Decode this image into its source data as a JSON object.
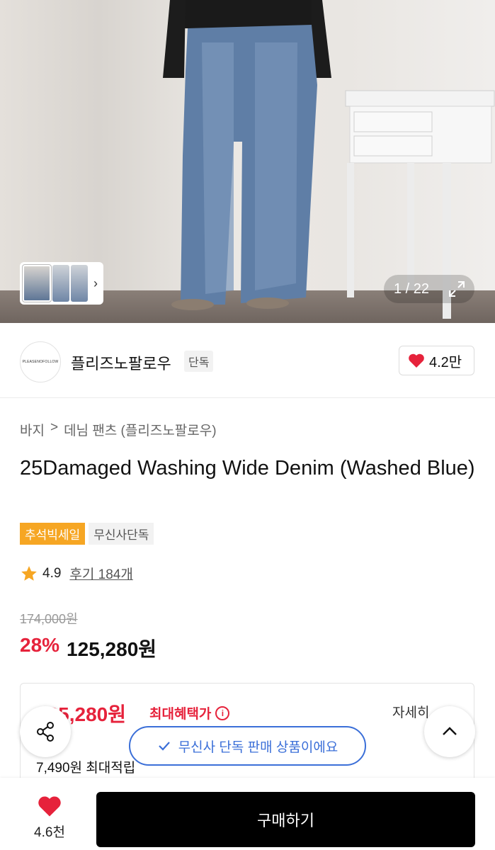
{
  "gallery": {
    "counter": "1 / 22",
    "thumb_chevron": "›"
  },
  "brand": {
    "logo_text": "PLEASENOFOLLOW",
    "name": "플리즈노팔로우",
    "badge": "단독",
    "likes": "4.2만"
  },
  "breadcrumb": [
    "바지",
    ">",
    "데님 팬츠 (플리즈노팔로우)"
  ],
  "product": {
    "title": "25Damaged Washing Wide Denim (Washed Blue)",
    "tags": [
      "추석빅세일",
      "무신사단독"
    ],
    "rating": "4.9",
    "reviews": "후기 184개",
    "original_price": "174,000원",
    "discount": "28%",
    "sale_price": "125,280원"
  },
  "benefit": {
    "price": "125,280원",
    "label": "최대혜택가",
    "info_icon": "i",
    "detail_link": "자세히",
    "points": "7,490원 최대적립"
  },
  "toast": "무신사 단독 판매 상품이에요",
  "bottom": {
    "wish_count": "4.6천",
    "buy_label": "구매하기"
  },
  "colors": {
    "accent_red": "#e6223b",
    "tag_orange": "#f6a623",
    "toast_blue": "#3b6fd8"
  }
}
